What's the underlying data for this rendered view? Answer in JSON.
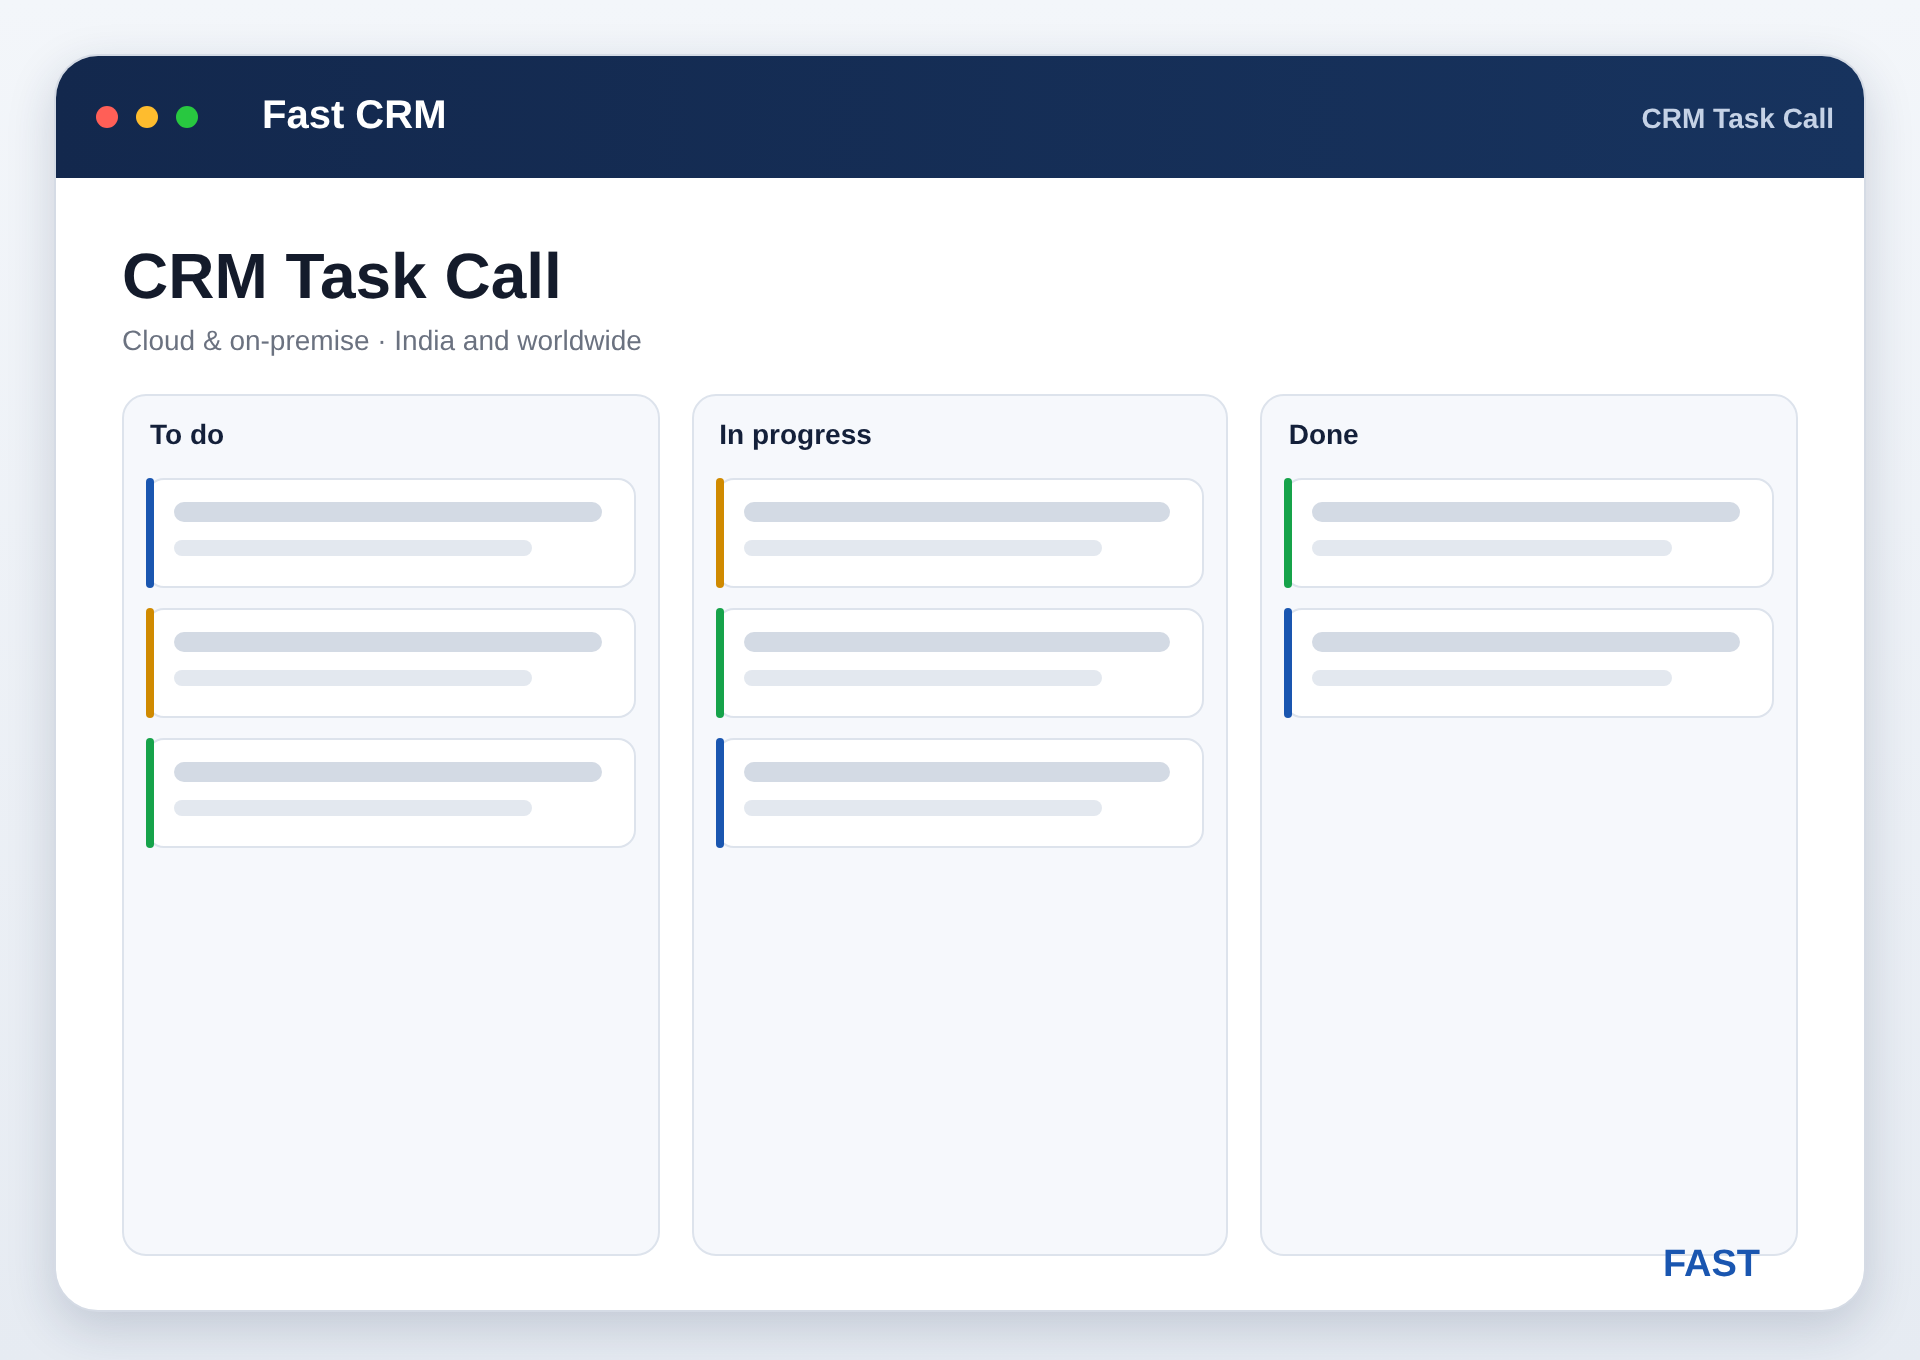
{
  "window": {
    "title": "Fast CRM",
    "context": "CRM Task Call"
  },
  "page": {
    "heading": "CRM Task Call",
    "subtitle": "Cloud & on-premise · India and worldwide"
  },
  "columns": [
    {
      "title": "To do",
      "cards": [
        {
          "color": "#1a56b0"
        },
        {
          "color": "#d08a00"
        },
        {
          "color": "#16a34a"
        }
      ]
    },
    {
      "title": "In progress",
      "cards": [
        {
          "color": "#d08a00"
        },
        {
          "color": "#16a34a"
        },
        {
          "color": "#1a56b0"
        }
      ]
    },
    {
      "title": "Done",
      "cards": [
        {
          "color": "#16a34a"
        },
        {
          "color": "#1a56b0"
        }
      ]
    }
  ],
  "brand": "FAST"
}
